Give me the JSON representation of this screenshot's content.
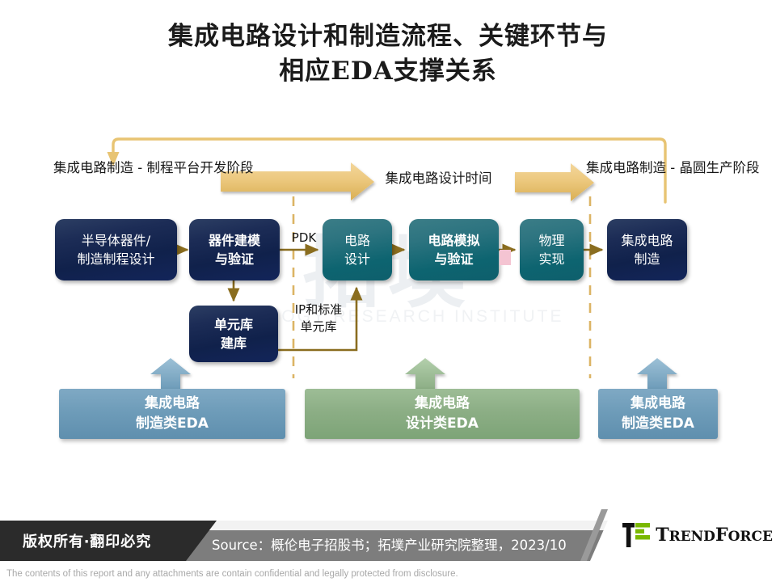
{
  "title": {
    "line1": "集成电路设计和制造流程、关键环节与",
    "line2": "相应EDA支撑关系"
  },
  "watermark": {
    "cjk": "拓墣",
    "english": "TOPOLOGY RESEARCH INSTITUTE"
  },
  "phases": [
    {
      "id": "left",
      "text": "集成电路制造 -\n制程平台开发阶段"
    },
    {
      "id": "mid",
      "text": "集成电路设计时间"
    },
    {
      "id": "right",
      "text": "集成电路制造 -\n晶圆生产阶段"
    }
  ],
  "nodes": [
    {
      "id": "semiconductor-device-design",
      "text": "半导体器件/\n制造制程设计",
      "color": "navy",
      "bold": false
    },
    {
      "id": "device-modeling-verification",
      "text": "器件建模\n与验证",
      "color": "navy",
      "bold": true
    },
    {
      "id": "cell-library-build",
      "text": "单元库\n建库",
      "color": "navy",
      "bold": true
    },
    {
      "id": "circuit-design",
      "text": "电路\n设计",
      "color": "teal",
      "bold": false
    },
    {
      "id": "circuit-simulation-verification",
      "text": "电路模拟\n与验证",
      "color": "teal",
      "bold": true
    },
    {
      "id": "physical-implementation",
      "text": "物理\n实现",
      "color": "teal",
      "bold": false
    },
    {
      "id": "ic-manufacturing",
      "text": "集成电路\n制造",
      "color": "navy",
      "bold": false
    }
  ],
  "connector_labels": [
    {
      "id": "pdk",
      "text": "PDK"
    },
    {
      "id": "ip",
      "text": "IP和标准\n单元库"
    }
  ],
  "eda_banners": [
    {
      "id": "eda-manufacturing-left",
      "text": "集成电路\n制造类EDA",
      "color": "blue"
    },
    {
      "id": "eda-design",
      "text": "集成电路\n设计类EDA",
      "color": "green"
    },
    {
      "id": "eda-manufacturing-right",
      "text": "集成电路\n制造类EDA",
      "color": "blue"
    }
  ],
  "footer": {
    "copyright": "版权所有‧翻印必究",
    "source": "Source：概伦电子招股书；拓墣产业研究院整理，2023/10",
    "logo_text_lead": "T",
    "logo_text_rest": "REND",
    "logo_text_lead2": "F",
    "logo_text_rest2": "ORCE",
    "disclaimer": "The contents of this report and any attachments are contain confidential and legally protected from disclosure."
  },
  "colors": {
    "navy": "#14255a",
    "teal": "#0e6571",
    "gold_arrow": "#e8c473",
    "connector": "#8a6d1f",
    "dashed": "#dcb464",
    "eda_blue": "#6e9cb9",
    "eda_green": "#8cae85",
    "footer_gray": "#7d7d7d",
    "footer_black": "#2b2b2b",
    "logo_green": "#7ab800"
  }
}
